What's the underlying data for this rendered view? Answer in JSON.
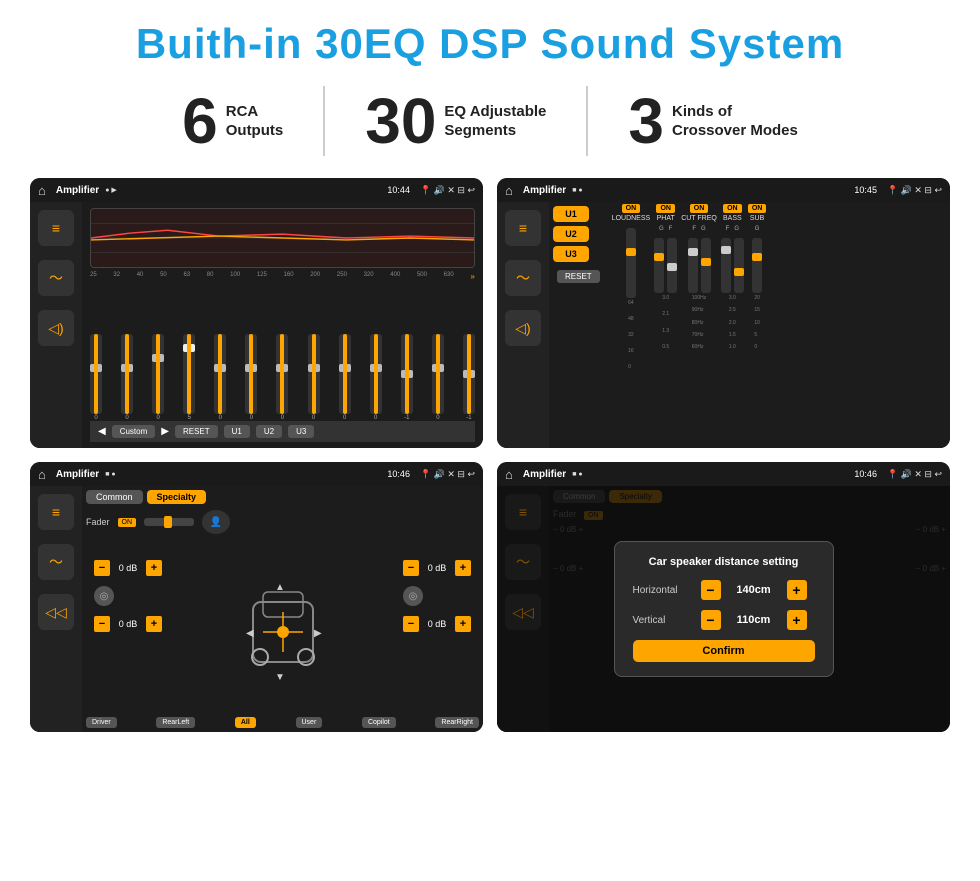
{
  "header": {
    "title": "Buith-in 30EQ DSP Sound System"
  },
  "stats": [
    {
      "number": "6",
      "label": "RCA\nOutputs"
    },
    {
      "number": "30",
      "label": "EQ Adjustable\nSegments"
    },
    {
      "number": "3",
      "label": "Kinds of\nCrossover Modes"
    }
  ],
  "screens": [
    {
      "id": "screen1",
      "status_bar": {
        "app": "Amplifier",
        "time": "10:44"
      },
      "eq_labels": [
        "25",
        "32",
        "40",
        "50",
        "63",
        "80",
        "100",
        "125",
        "160",
        "200",
        "250",
        "320",
        "400",
        "500",
        "630"
      ],
      "eq_values": [
        "0",
        "0",
        "0",
        "5",
        "0",
        "0",
        "0",
        "0",
        "0",
        "0",
        "-1",
        "0",
        "-1"
      ],
      "bottom_btns": [
        "Custom",
        "RESET",
        "U1",
        "U2",
        "U3"
      ]
    },
    {
      "id": "screen2",
      "status_bar": {
        "app": "Amplifier",
        "time": "10:45"
      },
      "presets": [
        "U1",
        "U2",
        "U3"
      ],
      "columns": [
        {
          "label": "LOUDNESS",
          "on": true
        },
        {
          "label": "PHAT",
          "on": true
        },
        {
          "label": "CUT FREQ",
          "on": true
        },
        {
          "label": "BASS",
          "on": true
        },
        {
          "label": "SUB",
          "on": true
        }
      ],
      "reset_label": "RESET"
    },
    {
      "id": "screen3",
      "status_bar": {
        "app": "Amplifier",
        "time": "10:46"
      },
      "tabs": [
        "Common",
        "Specialty"
      ],
      "fader_label": "Fader",
      "on_label": "ON",
      "db_rows": [
        {
          "val": "0 dB"
        },
        {
          "val": "0 dB"
        },
        {
          "val": "0 dB"
        },
        {
          "val": "0 dB"
        }
      ],
      "bottom_labels": [
        "Driver",
        "RearLeft",
        "All",
        "User",
        "Copilot",
        "RearRight"
      ]
    },
    {
      "id": "screen4",
      "status_bar": {
        "app": "Amplifier",
        "time": "10:46"
      },
      "tabs": [
        "Common",
        "Specialty"
      ],
      "dialog": {
        "title": "Car speaker distance setting",
        "rows": [
          {
            "label": "Horizontal",
            "value": "140cm"
          },
          {
            "label": "Vertical",
            "value": "110cm"
          }
        ],
        "confirm_label": "Confirm"
      }
    }
  ]
}
